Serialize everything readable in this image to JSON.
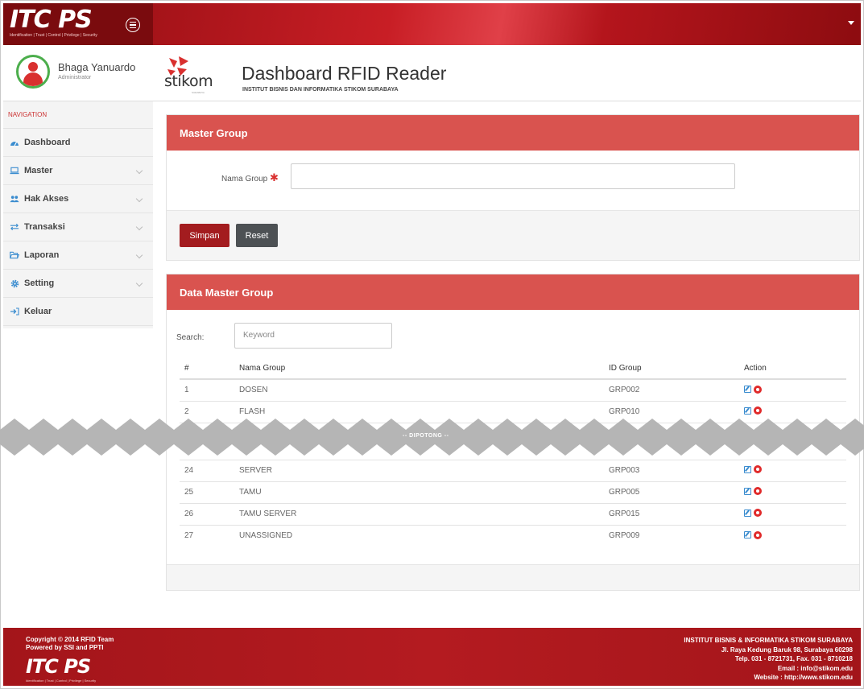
{
  "brand": {
    "logo": "ITC PS",
    "tagline": "Identification | Trust | Control | Privilege | Security"
  },
  "user": {
    "name": "Bhaga Yanuardo",
    "role": "Administrator"
  },
  "nav": {
    "title": "NAVIGATION",
    "items": [
      {
        "label": "Dashboard",
        "icon": "dashboard-icon"
      },
      {
        "label": "Master",
        "icon": "laptop-icon"
      },
      {
        "label": "Hak Akses",
        "icon": "users-icon"
      },
      {
        "label": "Transaksi",
        "icon": "exchange-icon"
      },
      {
        "label": "Laporan",
        "icon": "folder-icon"
      },
      {
        "label": "Setting",
        "icon": "gear-icon"
      },
      {
        "label": "Keluar",
        "icon": "logout-icon"
      }
    ]
  },
  "header": {
    "logo_text": "stikom",
    "logo_sub": "SURABAYA",
    "title": "Dashboard RFID Reader",
    "subtitle": "INSTITUT BISNIS DAN INFORMATIKA STIKOM SURABAYA"
  },
  "form": {
    "title": "Master Group",
    "label": "Nama Group",
    "required_mark": "✱",
    "value": "",
    "save_label": "Simpan",
    "reset_label": "Reset"
  },
  "data_panel": {
    "title": "Data Master Group",
    "search_label": "Search:",
    "search_placeholder": "Keyword",
    "columns": [
      "#",
      "Nama Group",
      "ID Group",
      "Action"
    ],
    "rows_top": [
      {
        "no": "1",
        "name": "DOSEN",
        "id": "GRP002"
      },
      {
        "no": "2",
        "name": "FLASH",
        "id": "GRP010"
      }
    ],
    "cut_label": "-- DIPOTONG --",
    "rows_bottom": [
      {
        "no": "24",
        "name": "SERVER",
        "id": "GRP003"
      },
      {
        "no": "25",
        "name": "TAMU",
        "id": "GRP005"
      },
      {
        "no": "26",
        "name": "TAMU SERVER",
        "id": "GRP015"
      },
      {
        "no": "27",
        "name": "UNASSIGNED",
        "id": "GRP009"
      }
    ]
  },
  "footer": {
    "copyright": "Copyright © 2014 RFID Team",
    "powered": "Powered by SSI and PPTI",
    "institute": "INSTITUT BISNIS & INFORMATIKA STIKOM SURABAYA",
    "address": "Jl. Raya Kedung Baruk 98, Surabaya 60298",
    "phone": "Telp. 031 - 8721731, Fax. 031 - 8710218",
    "email": "Email : info@stikom.edu",
    "website": "Website : http://www.stikom.edu"
  },
  "colors": {
    "brand_red": "#d9534f",
    "dark_red": "#a31c1f",
    "sidebar_bg": "#f4f4f4"
  }
}
